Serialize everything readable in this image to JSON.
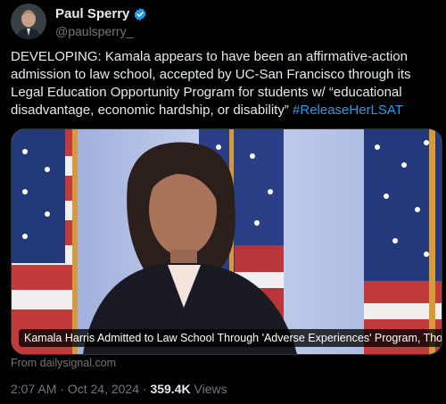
{
  "author": {
    "display_name": "Paul Sperry",
    "handle": "@paulsperry_",
    "verified_badge_icon": "verified-badge-icon"
  },
  "post": {
    "text": "DEVELOPING: Kamala appears to have been an affirmative-action admission to law school, accepted by UC-San Francisco through its Legal Education Opportunity Program for students w/ “educational disadvantage, economic hardship, or disability” ",
    "hashtag": "#ReleaseHerLSAT"
  },
  "card": {
    "title": "Kamala Harris Admitted to Law School Through 'Adverse Experiences' Program, Thoug...",
    "source": "From dailysignal.com"
  },
  "meta": {
    "time": "2:07 AM",
    "separator1": " · ",
    "date": "Oct 24, 2024",
    "separator2": " · ",
    "views_count": "359.4K",
    "views_label": " Views"
  },
  "colors": {
    "background": "#000000",
    "text": "#e7e9ea",
    "muted": "#71767b",
    "link": "#1d9bf0"
  }
}
